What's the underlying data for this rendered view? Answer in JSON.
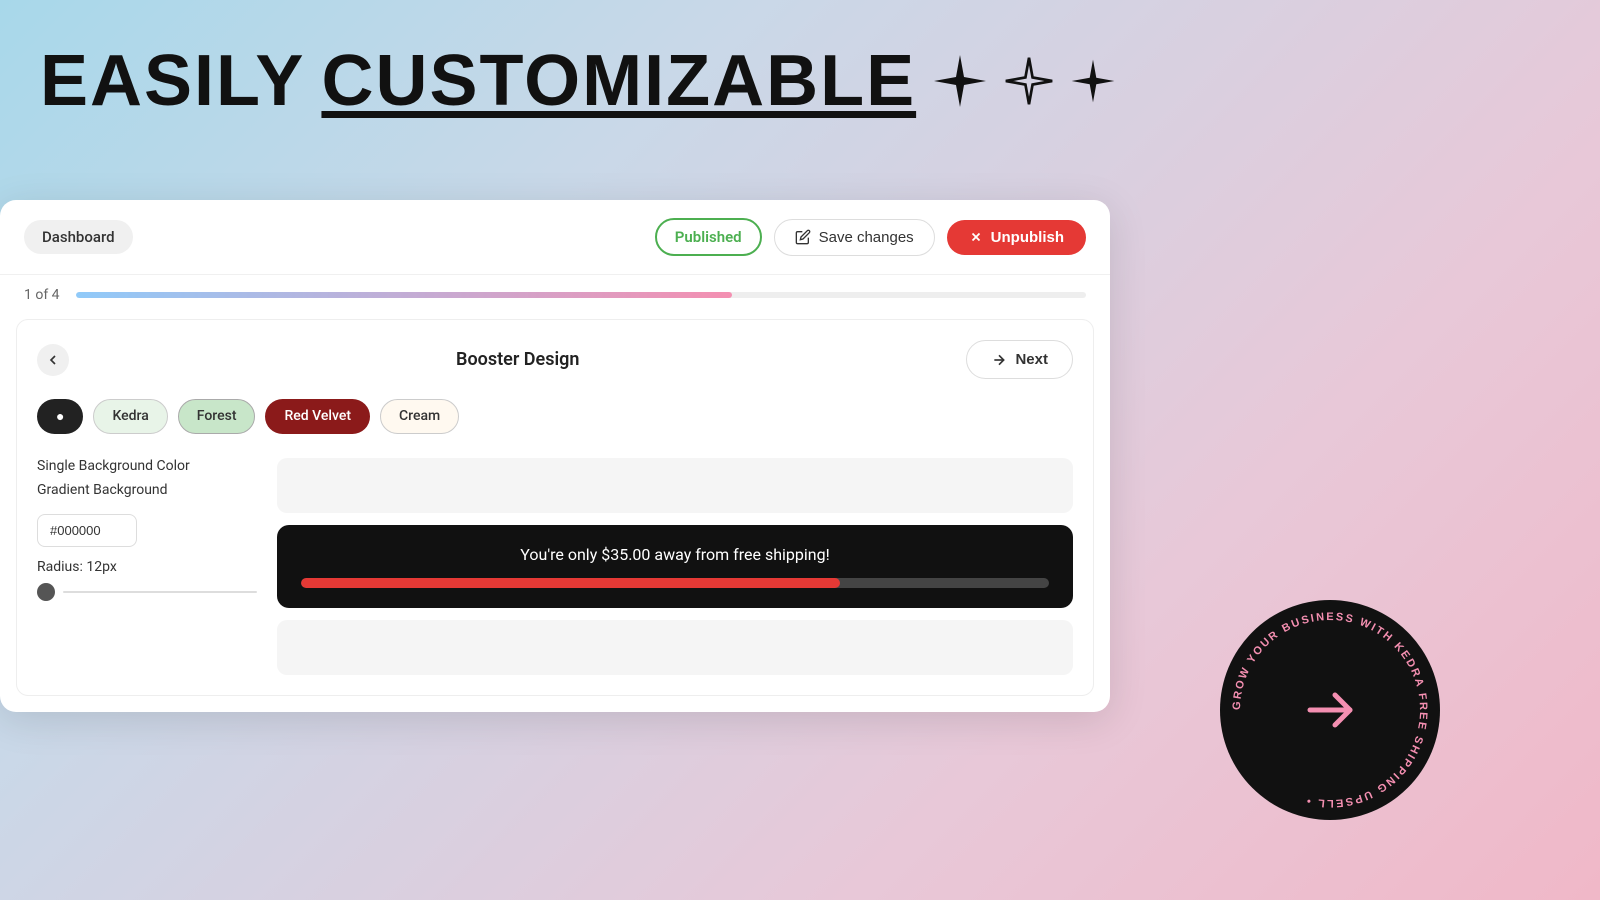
{
  "hero": {
    "title_part1": "EASILY",
    "title_part2": "CUSTOMIZABLE"
  },
  "header": {
    "dashboard_label": "Dashboard",
    "published_label": "Published",
    "save_changes_label": "Save changes",
    "unpublish_label": "Unpublish"
  },
  "progress": {
    "step_label": "f 4",
    "fill_percent": 65
  },
  "design_section": {
    "title": "Booster Design",
    "next_label": "Next"
  },
  "themes": [
    {
      "id": "dark",
      "label": "◉",
      "class": "dark-theme"
    },
    {
      "id": "kedra",
      "label": "Kedra",
      "class": "kedra"
    },
    {
      "id": "forest",
      "label": "Forest",
      "class": "forest"
    },
    {
      "id": "red-velvet",
      "label": "Red Velvet",
      "class": "red-velvet"
    },
    {
      "id": "cream",
      "label": "Cream",
      "class": "cream"
    }
  ],
  "left_panel": {
    "single_bg_label": "gle Background Color",
    "gradient_bg_label": "dient Background",
    "hex_value": "#000000",
    "radius_label": "Radius: 12px"
  },
  "shipping_bar": {
    "message": "You're only $35.00 away from free shipping!",
    "progress_percent": 72
  },
  "circular_badge": {
    "text": "GROW YOUR BUSINESS WITH KEDRA FREE SHIPPING UPSELL"
  },
  "colors": {
    "accent_green": "#4caf50",
    "accent_red": "#e53935",
    "progress_blue": "#90caf9",
    "progress_pink": "#f48fb1"
  }
}
